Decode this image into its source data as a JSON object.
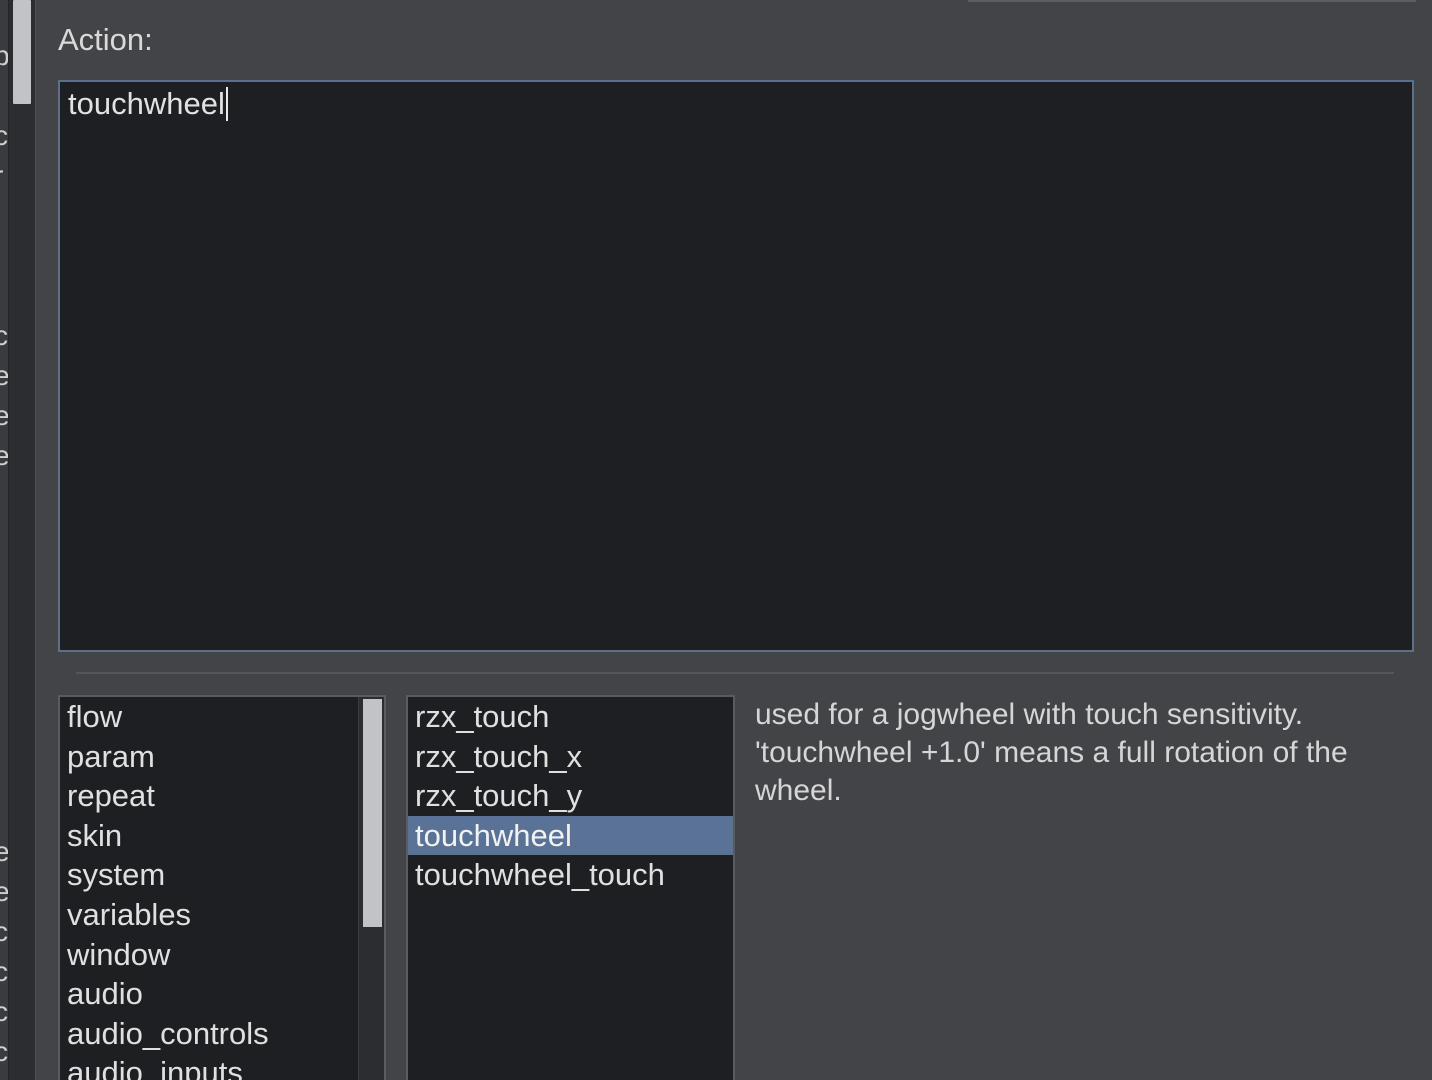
{
  "action": {
    "label": "Action:",
    "value": "touchwheel"
  },
  "categories": {
    "items": [
      "flow",
      "param",
      "repeat",
      "skin",
      "system",
      "variables",
      "window",
      "audio",
      "audio_controls",
      "audio_inputs"
    ]
  },
  "actions": {
    "items": [
      "rzx_touch",
      "rzx_touch_x",
      "rzx_touch_y",
      "touchwheel",
      "touchwheel_touch"
    ],
    "selected": "touchwheel"
  },
  "description": {
    "text": "used for a jogwheel with touch sensitivity. 'touchwheel +1.0' means a full rotation of the wheel."
  },
  "colors": {
    "background": "#434448",
    "editor_background": "#1e1f22",
    "editor_border": "#5c7089",
    "selection": "#5a7296"
  }
}
